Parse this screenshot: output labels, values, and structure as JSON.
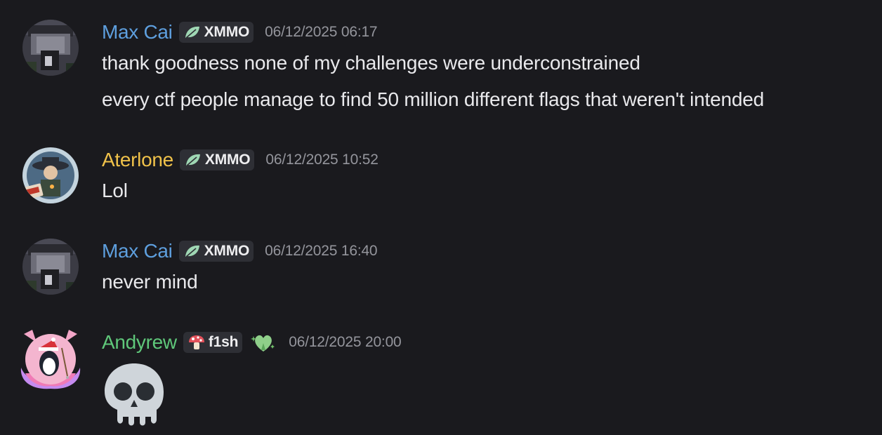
{
  "messages": [
    {
      "username": "Max Cai",
      "username_color": "#5e9fde",
      "tag": "XMMO",
      "tag_icon": "leaf-icon",
      "timestamp": "06/12/2025 06:17",
      "lines": [
        "thank goodness none of my challenges were underconstrained",
        "every ctf people manage to find 50 million different flags that weren't intended"
      ]
    },
    {
      "username": "Aterlone",
      "username_color": "#f0c24a",
      "tag": "XMMO",
      "tag_icon": "leaf-icon",
      "timestamp": "06/12/2025 10:52",
      "lines": [
        "Lol"
      ]
    },
    {
      "username": "Max Cai",
      "username_color": "#5e9fde",
      "tag": "XMMO",
      "tag_icon": "leaf-icon",
      "timestamp": "06/12/2025 16:40",
      "lines": [
        "never mind"
      ]
    },
    {
      "username": "Andyrew",
      "username_color": "#5fc77a",
      "tag": "f1sh",
      "tag_icon": "mushroom-icon",
      "extra_icon": "green-heart-sparkle-icon",
      "timestamp": "06/12/2025 20:00",
      "content_emoji": "skull-emoji"
    }
  ]
}
